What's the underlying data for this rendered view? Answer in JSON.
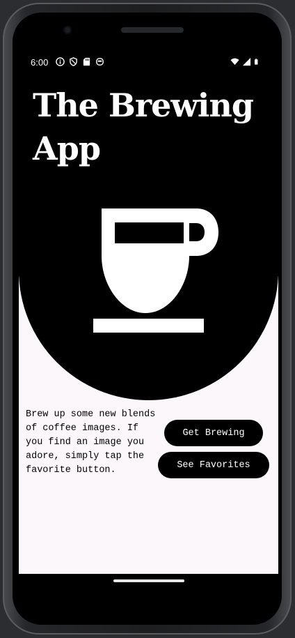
{
  "status_bar": {
    "time": "6:00",
    "left_icons": [
      "info-icon",
      "shield-icon",
      "sd-card-icon",
      "cloud-sync-icon"
    ],
    "right_icons": [
      "wifi-icon",
      "cell-signal-icon",
      "battery-icon"
    ]
  },
  "app": {
    "title": "The Brewing App",
    "hero_icon": "coffee-cup-icon",
    "description": "Brew up some new blends of coffee images. If you find an image you adore, simply tap the favorite button.",
    "buttons": {
      "get_brewing": "Get Brewing",
      "see_favorites": "See Favorites"
    }
  },
  "colors": {
    "background_dark": "#000000",
    "content_background": "#fcf7fb",
    "button_background": "#000000",
    "button_text": "#ffffff"
  }
}
